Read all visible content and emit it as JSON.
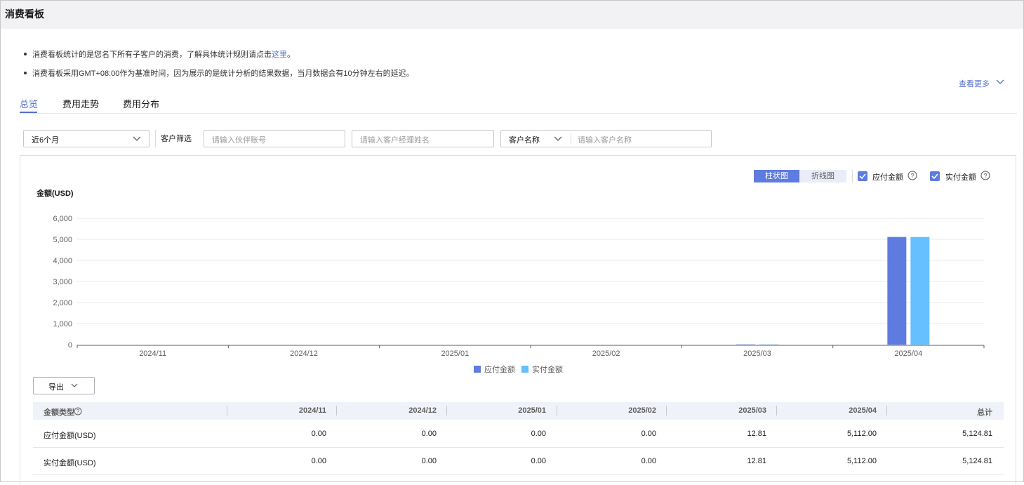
{
  "page": {
    "title": "消费看板"
  },
  "notes": [
    {
      "text": "消费看板统计的是您名下所有子客户的消费，了解具体统计规则请点击",
      "link": "这里",
      "suffix": "。"
    },
    {
      "text": "消费看板采用GMT+08:00作为基准时间，因为展示的是统计分析的结果数据，当月数据会有10分钟左右的延迟。"
    }
  ],
  "more": "查看更多",
  "tabs": [
    {
      "label": "总览",
      "active": true
    },
    {
      "label": "费用走势",
      "active": false
    },
    {
      "label": "费用分布",
      "active": false
    }
  ],
  "filters": {
    "period": "近6个月",
    "customer_filter_label": "客户筛选",
    "partner_account_placeholder": "请输入伙伴账号",
    "manager_name_placeholder": "请输入客户经理姓名",
    "customer_field": "客户名称",
    "customer_name_placeholder": "请输入客户名称"
  },
  "chart_controls": {
    "bar_label": "柱状图",
    "line_label": "折线图",
    "payable_checkbox": "应付金额",
    "paid_checkbox": "实付金额"
  },
  "colors": {
    "accent": "#526ecc",
    "series_payable": "#5e7ce0",
    "series_paid": "#66bfff"
  },
  "chart_data": {
    "type": "bar",
    "ylabel": "金额(USD)",
    "ylim": [
      0,
      6000
    ],
    "yticks": [
      "0",
      "1,000",
      "2,000",
      "3,000",
      "4,000",
      "5,000",
      "6,000"
    ],
    "categories": [
      "2024/11",
      "2024/12",
      "2025/01",
      "2025/02",
      "2025/03",
      "2025/04"
    ],
    "series": [
      {
        "name": "应付金额",
        "values": [
          0,
          0,
          0,
          0,
          12.81,
          5112
        ],
        "color": "#5e7ce0"
      },
      {
        "name": "实付金额",
        "values": [
          0,
          0,
          0,
          0,
          12.81,
          5112
        ],
        "color": "#66bfff"
      }
    ],
    "grid": true,
    "legend": "bottom-center"
  },
  "export_label": "导出",
  "table": {
    "headers": [
      "金额类型",
      "2024/11",
      "2024/12",
      "2025/01",
      "2025/02",
      "2025/03",
      "2025/04",
      "总计"
    ],
    "rows": [
      {
        "label": "应付金额(USD)",
        "values": [
          "0.00",
          "0.00",
          "0.00",
          "0.00",
          "12.81",
          "5,112.00",
          "5,124.81"
        ]
      },
      {
        "label": "实付金额(USD)",
        "values": [
          "0.00",
          "0.00",
          "0.00",
          "0.00",
          "12.81",
          "5,112.00",
          "5,124.81"
        ]
      }
    ]
  }
}
